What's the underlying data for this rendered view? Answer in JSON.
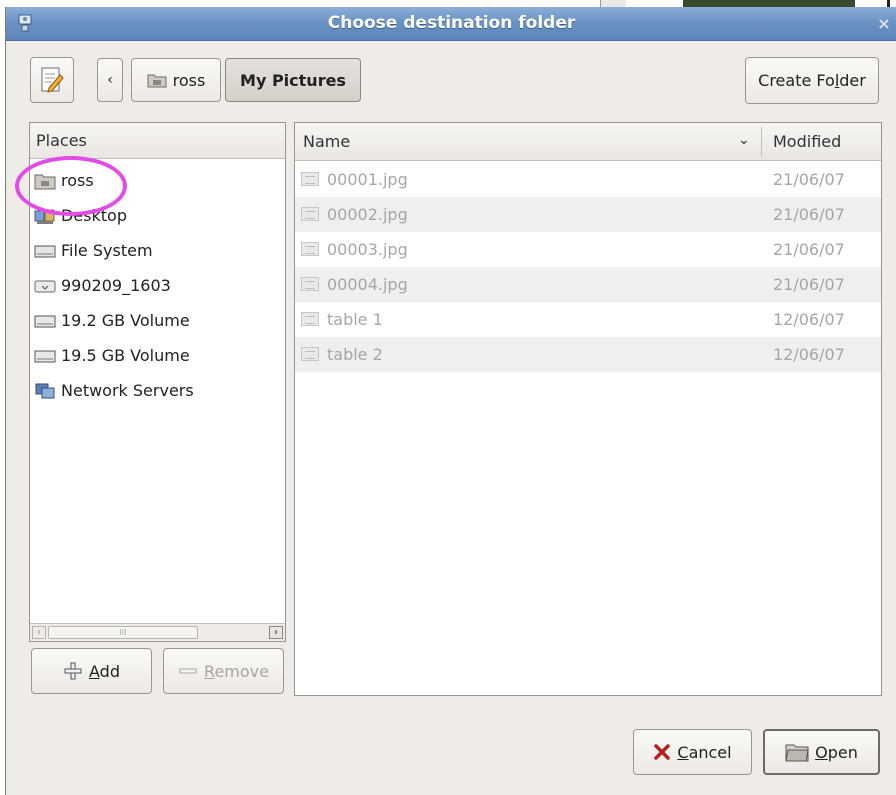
{
  "window": {
    "title": "Choose destination folder",
    "close_glyph": "×"
  },
  "toolbar": {
    "back_glyph": "‹",
    "breadcrumbs": [
      {
        "label": "ross",
        "icon": "home-folder-icon"
      },
      {
        "label": "My Pictures",
        "icon": ""
      }
    ],
    "create_folder_label": "Create Folder",
    "create_folder_parts": [
      "Create Fo",
      "l",
      "der"
    ]
  },
  "places": {
    "header": "Places",
    "items": [
      {
        "label": "ross",
        "icon": "home-folder-icon"
      },
      {
        "label": "Desktop",
        "icon": "desktop-icon"
      },
      {
        "label": "File System",
        "icon": "drive-icon"
      },
      {
        "label": "990209_1603",
        "icon": "removable-drive-icon"
      },
      {
        "label": "19.2 GB Volume",
        "icon": "volume-icon"
      },
      {
        "label": "19.5 GB Volume",
        "icon": "volume-icon"
      },
      {
        "label": "Network Servers",
        "icon": "network-icon"
      }
    ],
    "scroll_grip": "III",
    "add_label": "Add",
    "add_parts": [
      "",
      "A",
      "dd"
    ],
    "remove_label": "Remove",
    "remove_parts": [
      "",
      "R",
      "emove"
    ]
  },
  "files": {
    "columns": {
      "name": "Name",
      "modified": "Modified",
      "sort_glyph": "⌄"
    },
    "rows": [
      {
        "name": "00001.jpg",
        "modified": "21/06/07"
      },
      {
        "name": "00002.jpg",
        "modified": "21/06/07"
      },
      {
        "name": "00003.jpg",
        "modified": "21/06/07"
      },
      {
        "name": "00004.jpg",
        "modified": "21/06/07"
      },
      {
        "name": "table 1",
        "modified": "12/06/07"
      },
      {
        "name": "table 2",
        "modified": "12/06/07"
      }
    ]
  },
  "actions": {
    "cancel_label": "Cancel",
    "cancel_parts": [
      "",
      "C",
      "ancel"
    ],
    "open_label": "Open",
    "open_parts": [
      "",
      "O",
      "pen"
    ]
  },
  "colors": {
    "titlebar": "#6b93c4",
    "dialog_bg": "#efebe7",
    "highlight": "#e24be6",
    "disabled_text": "#a6a6a6"
  }
}
